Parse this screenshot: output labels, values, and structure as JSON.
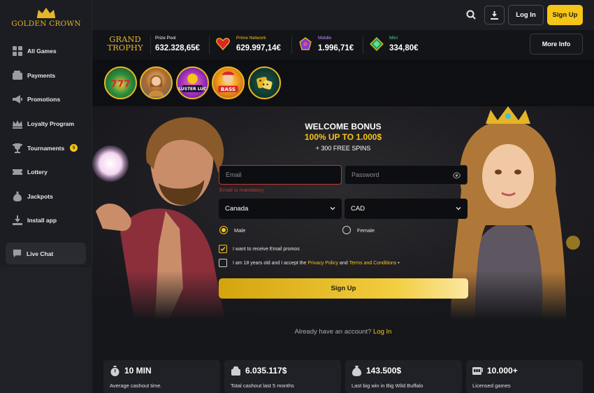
{
  "brand": {
    "logo_text": "GOLDEN CROWN",
    "accent": "#f5c518",
    "gold": "#e6b427",
    "error": "#c2362f"
  },
  "sidebar": {
    "items": [
      {
        "label": "All Games",
        "icon": "grid-icon"
      },
      {
        "label": "Payments",
        "icon": "wallet-icon"
      },
      {
        "label": "Promotions",
        "icon": "megaphone-icon"
      },
      {
        "label": "Loyalty Program",
        "icon": "crown-icon"
      },
      {
        "label": "Tournaments",
        "icon": "trophy-icon",
        "badge": "5"
      },
      {
        "label": "Lottery",
        "icon": "ticket-icon"
      },
      {
        "label": "Jackpots",
        "icon": "money-bag-icon"
      },
      {
        "label": "Install app",
        "icon": "download-icon"
      }
    ],
    "live_chat": "Live Chat"
  },
  "header": {
    "login_label": "Log In",
    "signup_label": "Sign Up"
  },
  "jackpots": {
    "grand_trophy_line1": "GRAND",
    "grand_trophy_line2": "TROPHY",
    "items": [
      {
        "label": "Prize Pool",
        "value": "632.328,65€",
        "label_color": "#ffffff"
      },
      {
        "label": "Prime Network",
        "value": "629.997,14€",
        "label_color": "#f5c518"
      },
      {
        "label": "Middle",
        "value": "1.996,71€",
        "label_color": "#c48cff"
      },
      {
        "label": "Mini",
        "value": "334,80€",
        "label_color": "#4fd38a"
      }
    ],
    "more_info": "More Info"
  },
  "games": [
    "game-1",
    "game-2",
    "game-3",
    "game-4",
    "game-5"
  ],
  "signup": {
    "title": "WELCOME BONUS",
    "offer": "100% UP TO 1.000$",
    "spins": "+ 300 FREE SPINS",
    "email_placeholder": "Email",
    "email_error": "Email is mandatory",
    "password_placeholder": "Password",
    "country": "Canada",
    "currency": "CAD",
    "gender_male": "Male",
    "gender_female": "Female",
    "gender_selected": "Male",
    "promo_label": "I want to receive Email promos",
    "promo_checked": true,
    "age_prefix": "I am 18 years old and I accept the ",
    "privacy_link": "Privacy Policy",
    "and": " and ",
    "terms_link": "Terms and Conditions",
    "age_suffix": " •",
    "age_checked": false,
    "submit": "Sign Up",
    "already_text": "Already have an account?",
    "already_link": "Log In"
  },
  "stats": [
    {
      "value": "10 MIN",
      "label": "Average cashout time.",
      "icon": "stopwatch-icon"
    },
    {
      "value": "6.035.117$",
      "label": "Total cashout last 5 months",
      "icon": "cash-icon"
    },
    {
      "value": "143.500$",
      "label": "Last big win in Big Wild Buffalo",
      "icon": "money-bag-icon"
    },
    {
      "value": "10.000+",
      "label": "Licensed games",
      "icon": "slot-machine-icon"
    }
  ]
}
